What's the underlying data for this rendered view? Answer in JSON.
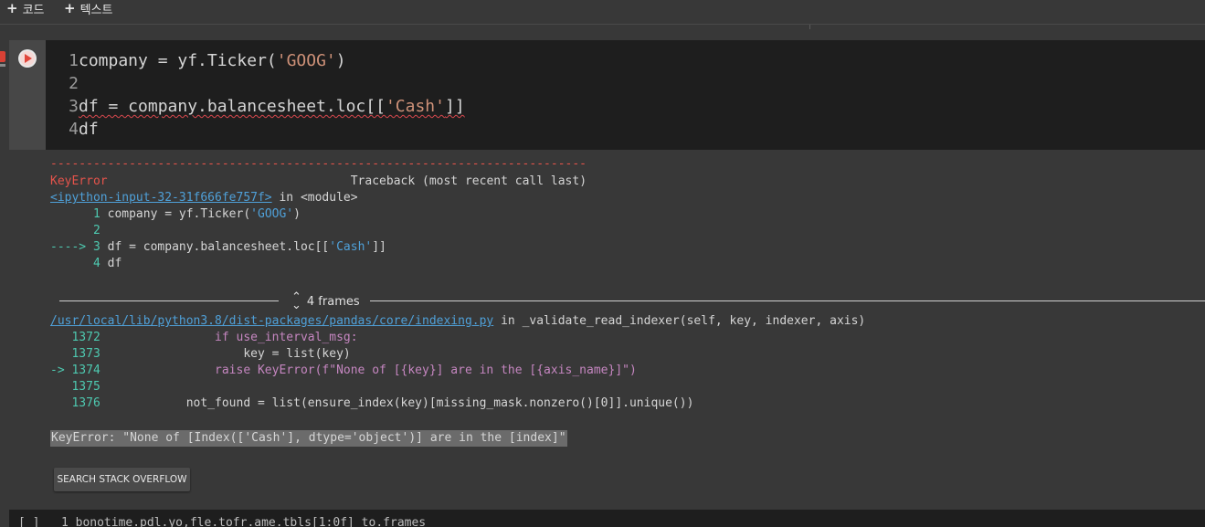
{
  "toolbar": {
    "add_code_label": "코드",
    "add_text_label": "텍스트",
    "plus": "+"
  },
  "editor": {
    "lines": [
      {
        "num": "1",
        "pre": "company = yf.Ticker(",
        "str": "'GOOG'",
        "post": ")"
      },
      {
        "num": "2",
        "pre": "",
        "str": "",
        "post": ""
      },
      {
        "num": "3",
        "pre": "df = company.balancesheet.loc[[",
        "str": "'Cash'",
        "post": "]]"
      },
      {
        "num": "4",
        "pre": "df",
        "str": "",
        "post": ""
      }
    ]
  },
  "output": {
    "dashes": "---------------------------------------------------------------------------",
    "error_type": "KeyError",
    "traceback_header": "Traceback (most recent call last)",
    "input_link": "<ipython-input-32-31f666fe757f>",
    "in_module": " in <module>",
    "tb1": [
      {
        "prefix": "      ",
        "num": "1",
        "code": "company = yf.Ticker(",
        "str": "'GOOG'",
        "post": ")"
      },
      {
        "prefix": "      ",
        "num": "2",
        "code": "",
        "str": "",
        "post": ""
      },
      {
        "prefix": "----> ",
        "num": "3",
        "code": "df = company.balancesheet.loc[[",
        "str": "'Cash'",
        "post": "]]"
      },
      {
        "prefix": "      ",
        "num": "4",
        "code": "df",
        "str": "",
        "post": ""
      }
    ],
    "frames_label": "4 frames",
    "file_link": "/usr/local/lib/python3.8/dist-packages/pandas/core/indexing.py",
    "file_func": " in _validate_read_indexer(self, key, indexer, axis)",
    "tb2": [
      {
        "prefix": "   ",
        "num": "1372",
        "code": "                if use_interval_msg:"
      },
      {
        "prefix": "   ",
        "num": "1373",
        "code": "                    key = list(key)"
      },
      {
        "prefix": "-> ",
        "num": "1374",
        "code": "                raise KeyError(f\"None of [{key}] are in the [{axis_name}]\")"
      },
      {
        "prefix": "   ",
        "num": "1375",
        "code": ""
      },
      {
        "prefix": "   ",
        "num": "1376",
        "code": "            not_found = list(ensure_index(key)[missing_mask.nonzero()[0]].unique())"
      }
    ],
    "error_message": "KeyError: \"None of [Index(['Cash'], dtype='object')] are in the [index]\"",
    "search_button": "SEARCH STACK OVERFLOW"
  },
  "next_cell": {
    "text": "[ ]   1 bonotime.pdl.yo,fle.tofr.ame.tbls[1:0f] to.frames"
  },
  "colors": {
    "editor_bg": "#1e1e1e",
    "page_bg": "#383838",
    "error_red": "#e5534b",
    "link_blue": "#4fa0d8",
    "string_orange": "#ce9178"
  }
}
